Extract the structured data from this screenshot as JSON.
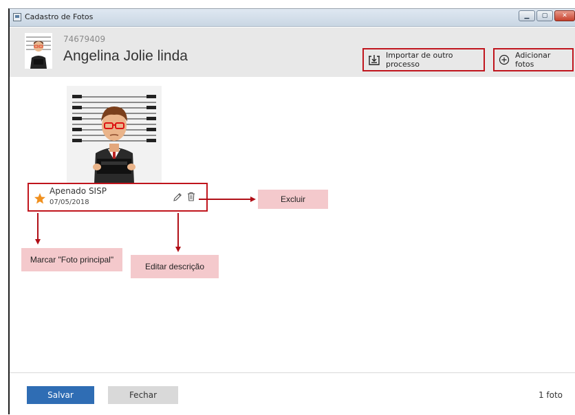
{
  "window": {
    "title": "Cadastro de Fotos",
    "controls": [
      "minimize-icon",
      "maximize-icon",
      "close-icon"
    ]
  },
  "header": {
    "record_id": "74679409",
    "person_name": "Angelina Jolie linda",
    "import_button_label": "Importar de outro processo",
    "add_button_label": "Adicionar fotos"
  },
  "photos": [
    {
      "description": "Apenado SISP",
      "date": "07/05/2018",
      "is_main": true
    }
  ],
  "callouts": {
    "excluir": "Excluir",
    "marcar": "Marcar \"Foto principal\"",
    "editar": "Editar descrição"
  },
  "footer": {
    "save_label": "Salvar",
    "close_label": "Fechar",
    "count_label": "1 foto"
  },
  "colors": {
    "highlight_border": "#c0141c",
    "callout_bg": "#f4c9cc",
    "primary_button": "#2f6db4",
    "star": "#f0901e"
  }
}
